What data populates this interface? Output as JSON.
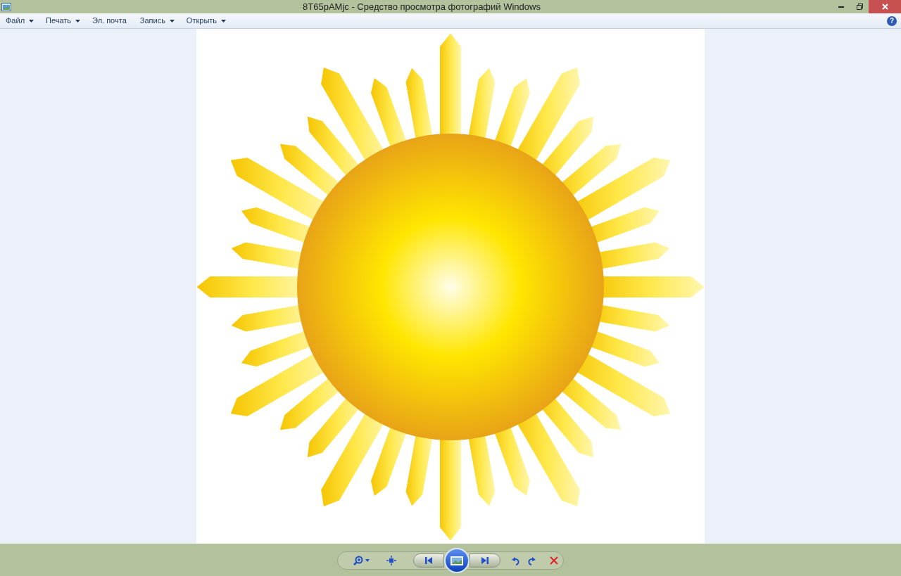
{
  "window": {
    "title": "8T65pAMjc - Средство просмотра фотографий Windows"
  },
  "menu": [
    {
      "label": "Файл",
      "dropdown": true
    },
    {
      "label": "Печать",
      "dropdown": true
    },
    {
      "label": "Эл. почта",
      "dropdown": false
    },
    {
      "label": "Запись",
      "dropdown": true
    },
    {
      "label": "Открыть",
      "dropdown": true
    }
  ],
  "help_button": {
    "label": "?"
  }
}
